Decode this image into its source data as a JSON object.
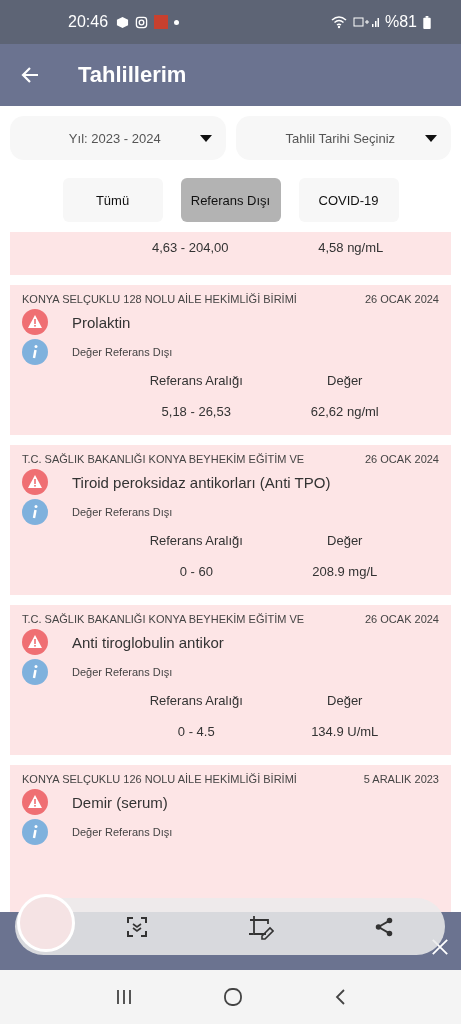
{
  "status_bar": {
    "time": "20:46",
    "battery": "%81"
  },
  "app_bar": {
    "title": "Tahlillerim"
  },
  "filters": [
    {
      "label": "Yıl: 2023 - 2024"
    },
    {
      "label": "Tahlil Tarihi Seçiniz"
    }
  ],
  "tabs": [
    {
      "label": "Tümü",
      "selected": false
    },
    {
      "label": "Referans Dışı",
      "selected": true
    },
    {
      "label": "COVID-19",
      "selected": false
    }
  ],
  "results": [
    {
      "kind": "partial",
      "range": "4,63 - 204,00",
      "value": "4,58 ng/mL"
    },
    {
      "kind": "full",
      "institution": "KONYA SELÇUKLU 128 NOLU AİLE HEKİMLİĞİ BİRİMİ",
      "date": "26 OCAK 2024",
      "test": "Prolaktin",
      "status": "Değer Referans Dışı",
      "range_label": "Referans Aralığı",
      "value_label": "Değer",
      "range": "5,18 - 26,53",
      "value": "62,62 ng/ml"
    },
    {
      "kind": "full",
      "institution": "T.C. SAĞLIK BAKANLIĞI KONYA BEYHEKİM EĞİTİM VE",
      "date": "26 OCAK 2024",
      "test": "Tiroid peroksidaz antikorları (Anti TPO)",
      "status": "Değer Referans Dışı",
      "range_label": "Referans Aralığı",
      "value_label": "Değer",
      "range": "0 - 60",
      "value": "208.9 mg/L"
    },
    {
      "kind": "full",
      "institution": "T.C. SAĞLIK BAKANLIĞI KONYA BEYHEKİM EĞİTİM VE",
      "date": "26 OCAK 2024",
      "test": "Anti tiroglobulin antikor",
      "status": "Değer Referans Dışı",
      "range_label": "Referans Aralığı",
      "value_label": "Değer",
      "range": "0 - 4.5",
      "value": "134.9 U/mL"
    },
    {
      "kind": "header",
      "institution": "KONYA SELÇUKLU 126 NOLU AİLE HEKİMLİĞİ BİRİMİ",
      "date": "5 ARALIK 2023",
      "test": "Demir (serum)",
      "status": "Değer Referans Dışı"
    }
  ]
}
